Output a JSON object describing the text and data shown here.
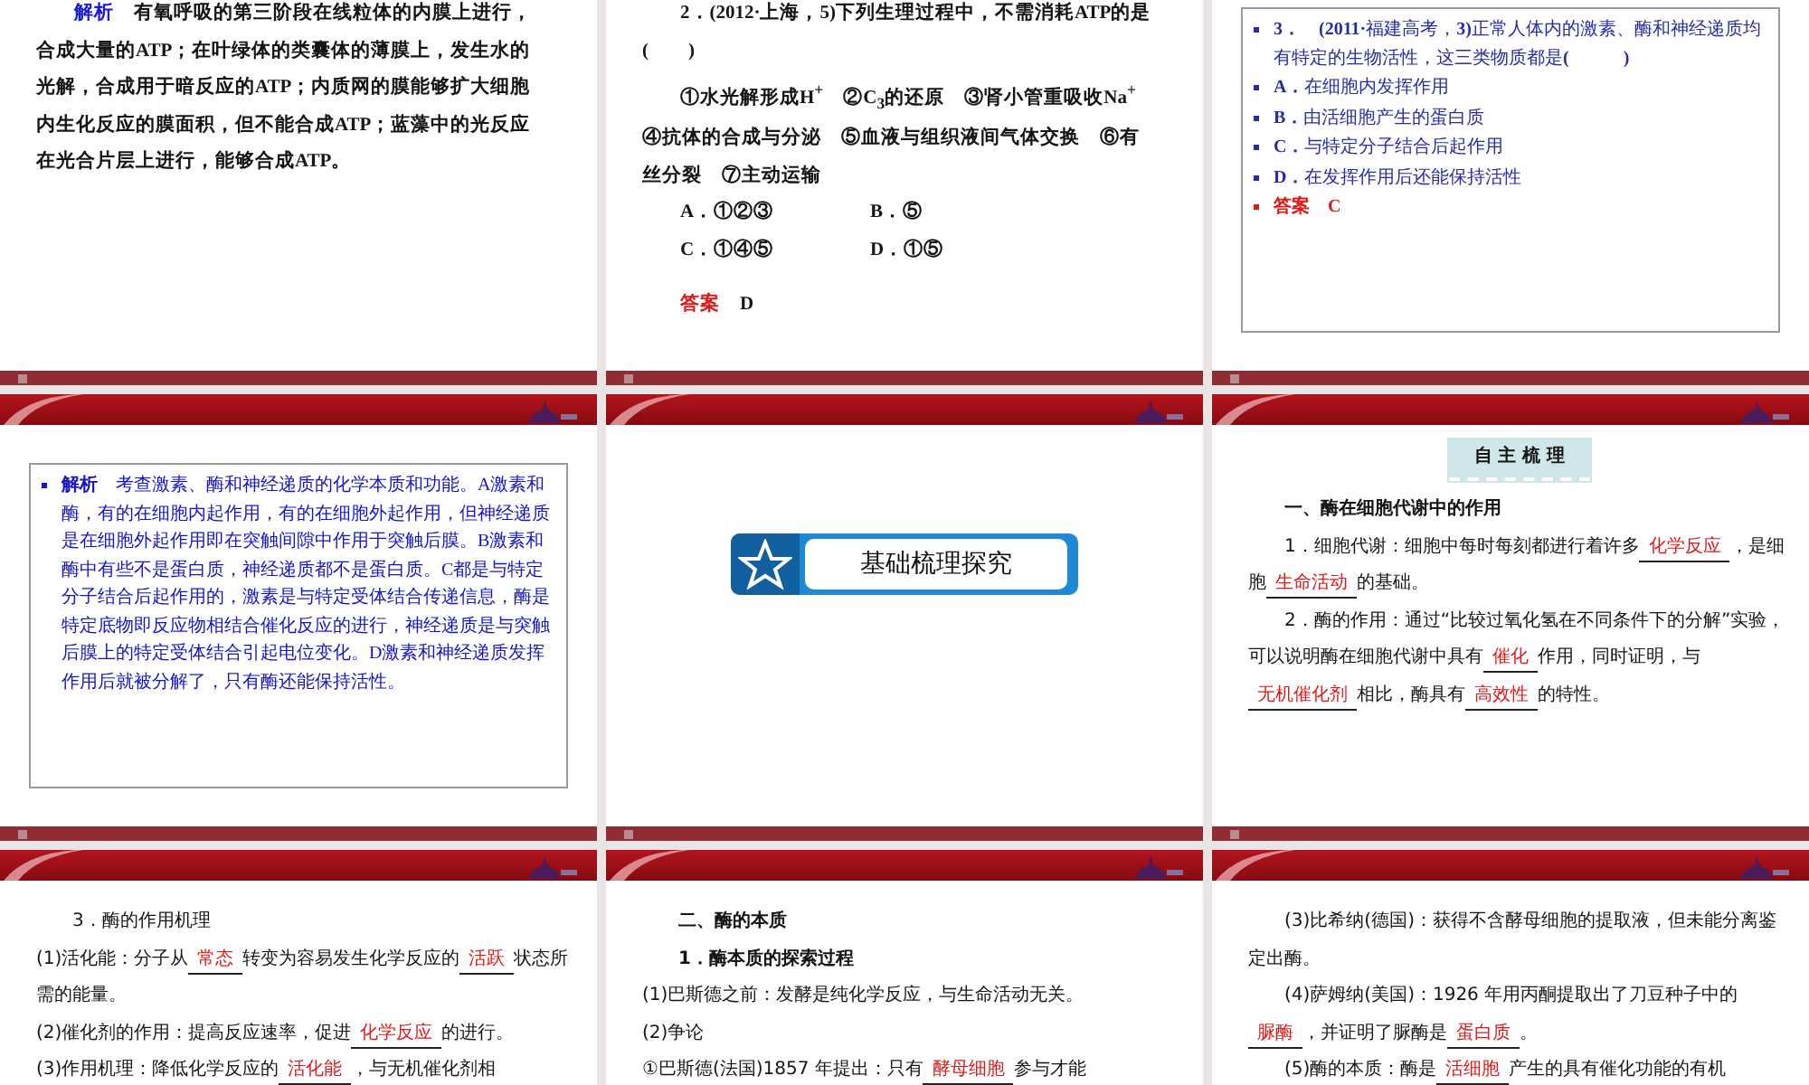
{
  "slides": [
    {
      "kind": "exercise",
      "paragraphs": [
        {
          "kind": "indent",
          "parts": [
            {
              "kind": "label",
              "text": "解析",
              "color": "#1a1adf"
            },
            {
              "kind": "text",
              "text": "　有氧呼吸的第三阶段在线粒体的内膜上进行，合成大量的ATP；在叶绿体的类囊体的薄膜上，发生水的光解，合成用于暗反应的ATP；内质网的膜能够扩大细胞内生化反应的膜面积，但不能合成ATP；蓝藻中的光反应在光合片层上进行，能够合成ATP。"
            }
          ]
        }
      ]
    },
    {
      "kind": "exercise",
      "paragraphs": [
        {
          "kind": "indent",
          "parts": [
            {
              "kind": "text",
              "text": "2．(2012·上海，5)下列生理过程中，不需消耗ATP的是(　　)"
            }
          ]
        },
        {
          "kind": "indent",
          "parts": [
            {
              "kind": "text",
              "text": "①水光解形成H$^{+}$　②C$_{3}$的还原　③肾小管重吸收Na$^{+}$　④抗体的合成与分泌　⑤血液与组织液间气体交换　⑥有丝分裂　⑦主动运输"
            }
          ]
        },
        {
          "kind": "options",
          "options": [
            "A．①②③",
            "B．⑤",
            "C．①④⑤",
            "D．①⑤"
          ]
        },
        {
          "kind": "answer",
          "parts": [
            {
              "kind": "label",
              "text": "答案",
              "color": "#e01818"
            },
            {
              "kind": "text",
              "text": "　D"
            }
          ]
        }
      ]
    },
    {
      "kind": "boxed",
      "paragraphs": [
        {
          "kind": "bullet",
          "color": "#2b2ba8",
          "parts": [
            {
              "kind": "text",
              "text": "**3．　(2011·**福建高考，**3)**正常人体内的激素、酶和神经递质均有特定的生物活性，这三类物质都是**(　　　)**"
            }
          ]
        },
        {
          "kind": "bullet",
          "color": "#2b2ba8",
          "parts": [
            {
              "kind": "text",
              "text": "**A．**在细胞内发挥作用"
            }
          ]
        },
        {
          "kind": "bullet",
          "color": "#2b2ba8",
          "parts": [
            {
              "kind": "text",
              "text": "**B．**由活细胞产生的蛋白质"
            }
          ]
        },
        {
          "kind": "bullet",
          "color": "#2b2ba8",
          "parts": [
            {
              "kind": "text",
              "text": "**C．**与特定分子结合后起作用"
            }
          ]
        },
        {
          "kind": "bullet",
          "color": "#2b2ba8",
          "parts": [
            {
              "kind": "text",
              "text": "**D．**在发挥作用后还能保持活性"
            }
          ]
        },
        {
          "kind": "bullet",
          "color": "#e01818",
          "parts": [
            {
              "kind": "label",
              "text": "答案",
              "color": "#e01818"
            },
            {
              "kind": "text",
              "text": "　**C**"
            }
          ]
        }
      ]
    },
    {
      "kind": "boxed",
      "paragraphs": [
        {
          "kind": "bullet",
          "color": "#1515c8",
          "parts": [
            {
              "kind": "label",
              "text": "解析",
              "color": "#1515c8"
            },
            {
              "kind": "text",
              "text": "　考查激素、酶和神经递质的化学本质和功能。A激素和酶，有的在细胞内起作用，有的在细胞外起作用，但神经递质是在细胞外起作用即在突触间隙中作用于突触后膜。B激素和酶中有些不是蛋白质，神经递质都不是蛋白质。C都是与特定分子结合后起作用的，激素是与特定受体结合传递信息，酶是特定底物即反应物相结合催化反应的进行，神经递质是与突触后膜上的特定受体结合引起电位变化。D激素和神经递质发挥作用后就被分解了，只有酶还能保持活性。"
            }
          ]
        }
      ]
    },
    {
      "kind": "section",
      "title": "基础梳理探究"
    },
    {
      "kind": "notes",
      "tag": "自 主 梳 理",
      "paragraphs": [
        {
          "kind": "heading",
          "parts": [
            {
              "kind": "text",
              "text": "一、酶在细胞代谢中的作用"
            }
          ]
        },
        {
          "kind": "indent",
          "parts": [
            {
              "kind": "text",
              "text": "1．细胞代谢：细胞中每时每刻都进行着许多"
            },
            {
              "kind": "blank",
              "text": "化学反应"
            },
            {
              "kind": "text",
              "text": "，是细胞"
            },
            {
              "kind": "blank",
              "text": "生命活动"
            },
            {
              "kind": "text",
              "text": "的基础。"
            }
          ]
        },
        {
          "kind": "indent",
          "parts": [
            {
              "kind": "text",
              "text": "2．酶的作用：通过“比较过氧化氢在不同条件下的分解”实验，可以说明酶在细胞代谢中具有"
            },
            {
              "kind": "blank",
              "text": "催化"
            },
            {
              "kind": "text",
              "text": "作用，同时证明，与"
            },
            {
              "kind": "blank",
              "text": "无机催化剂"
            },
            {
              "kind": "text",
              "text": "相比，酶具有"
            },
            {
              "kind": "blank",
              "text": "高效性"
            },
            {
              "kind": "text",
              "text": "的特性。"
            }
          ]
        }
      ]
    },
    {
      "kind": "notes",
      "paragraphs": [
        {
          "kind": "indent",
          "parts": [
            {
              "kind": "text",
              "text": "3．酶的作用机理"
            }
          ]
        },
        {
          "kind": "flush",
          "parts": [
            {
              "kind": "text",
              "text": "(1)活化能：分子从"
            },
            {
              "kind": "blank",
              "text": "常态"
            },
            {
              "kind": "text",
              "text": "转变为容易发生化学反应的"
            },
            {
              "kind": "blank",
              "text": "活跃"
            },
            {
              "kind": "text",
              "text": "状态所需的能量。"
            }
          ]
        },
        {
          "kind": "flush",
          "parts": [
            {
              "kind": "text",
              "text": "(2)催化剂的作用：提高反应速率，促进"
            },
            {
              "kind": "blank",
              "text": "化学反应"
            },
            {
              "kind": "text",
              "text": "的进行。"
            }
          ]
        },
        {
          "kind": "flush",
          "parts": [
            {
              "kind": "text",
              "text": "(3)作用机理：降低化学反应的"
            },
            {
              "kind": "blank",
              "text": "活化能"
            },
            {
              "kind": "text",
              "text": "，与无机催化剂相"
            }
          ]
        }
      ]
    },
    {
      "kind": "notes",
      "paragraphs": [
        {
          "kind": "heading",
          "parts": [
            {
              "kind": "text",
              "text": "二、酶的本质"
            }
          ]
        },
        {
          "kind": "heading",
          "parts": [
            {
              "kind": "text",
              "text": "1．酶本质的探索过程"
            }
          ]
        },
        {
          "kind": "flush",
          "parts": [
            {
              "kind": "text",
              "text": "(1)巴斯德之前：发酵是纯化学反应，与生命活动无关。"
            }
          ]
        },
        {
          "kind": "flush",
          "parts": [
            {
              "kind": "text",
              "text": "(2)争论"
            }
          ]
        },
        {
          "kind": "flush",
          "parts": [
            {
              "kind": "text",
              "text": "①巴斯德(法国)1857 年提出：只有"
            },
            {
              "kind": "blank",
              "text": "酵母细胞"
            },
            {
              "kind": "text",
              "text": "参与才能"
            }
          ]
        }
      ]
    },
    {
      "kind": "notes",
      "paragraphs": [
        {
          "kind": "indent",
          "parts": [
            {
              "kind": "text",
              "text": "(3)比希纳(德国)：获得不含酵母细胞的提取液，但未能分离鉴定出酶。"
            }
          ]
        },
        {
          "kind": "indent",
          "parts": [
            {
              "kind": "text",
              "text": "(4)萨姆纳(美国)：1926 年用丙酮提取出了刀豆种子中的"
            },
            {
              "kind": "blank",
              "text": "脲酶"
            },
            {
              "kind": "text",
              "text": "，并证明了脲酶是"
            },
            {
              "kind": "blank",
              "text": "蛋白质"
            },
            {
              "kind": "text",
              "text": "。"
            }
          ]
        },
        {
          "kind": "indent",
          "parts": [
            {
              "kind": "text",
              "text": "(5)酶的本质：酶是"
            },
            {
              "kind": "blank",
              "text": "活细胞"
            },
            {
              "kind": "text",
              "text": "产生的具有催化功能的有机"
            }
          ]
        }
      ]
    }
  ]
}
